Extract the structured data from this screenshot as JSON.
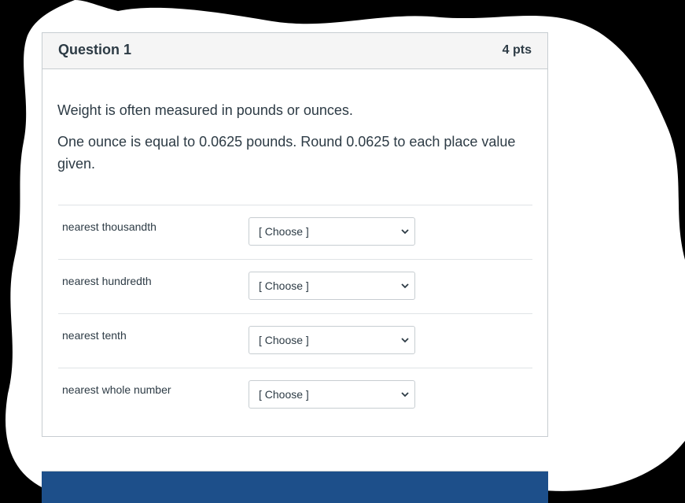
{
  "question": {
    "title": "Question 1",
    "points": "4 pts",
    "paragraphs": [
      "Weight is often measured in pounds or ounces.",
      "One ounce is equal to 0.0625 pounds. Round 0.0625 to each place value given."
    ]
  },
  "answers": [
    {
      "label": "nearest thousandth",
      "selected": "[ Choose ]"
    },
    {
      "label": "nearest hundredth",
      "selected": "[ Choose ]"
    },
    {
      "label": "nearest tenth",
      "selected": "[ Choose ]"
    },
    {
      "label": "nearest whole number",
      "selected": "[ Choose ]"
    }
  ],
  "colors": {
    "header_bg": "#f5f5f5",
    "text": "#2d3b45",
    "border": "#c7cdd1",
    "backdrop": "#000000"
  },
  "icons": {
    "dropdown": "chevron-down-icon"
  }
}
